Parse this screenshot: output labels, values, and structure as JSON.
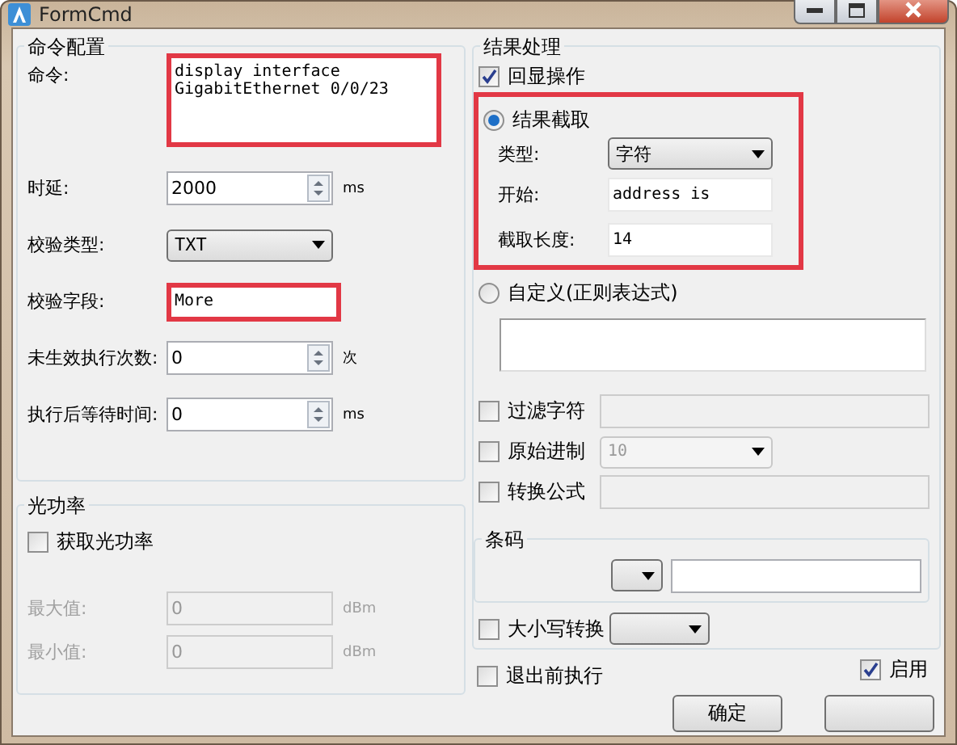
{
  "window": {
    "title": "FormCmd"
  },
  "command_config": {
    "title": "命令配置",
    "rows": [
      {
        "kind": "textarea",
        "label": "命令:",
        "value": "display interface\nGigabitEthernet 0/0/23",
        "highlighted": true
      },
      {
        "kind": "spin",
        "label": "时延:",
        "value": "2000",
        "unit": "ms"
      },
      {
        "kind": "combo",
        "label": "校验类型:",
        "value": "TXT"
      },
      {
        "kind": "text",
        "label": "校验字段:",
        "value": "More",
        "highlighted": true
      },
      {
        "kind": "spin",
        "label": "未生效执行次数:",
        "value": "0",
        "unit": "次"
      },
      {
        "kind": "spin",
        "label": "执行后等待时间:",
        "value": "0",
        "unit": "ms"
      }
    ]
  },
  "optical_power": {
    "title": "光功率",
    "checkbox": {
      "label": "获取光功率",
      "checked": false
    },
    "rows": [
      {
        "label": "最大值:",
        "value": "0",
        "unit": "dBm",
        "disabled": true
      },
      {
        "label": "最小值:",
        "value": "0",
        "unit": "dBm",
        "disabled": true
      }
    ]
  },
  "result": {
    "title": "结果处理",
    "echo": {
      "label": "回显操作",
      "checked": true
    },
    "extract": {
      "label": "结果截取",
      "selected": true,
      "highlighted": true,
      "rows": [
        {
          "kind": "combo",
          "label": "类型:",
          "value": "字符"
        },
        {
          "kind": "text",
          "label": "开始:",
          "value": "address is"
        },
        {
          "kind": "text",
          "label": "截取长度:",
          "value": "14"
        }
      ]
    },
    "custom": {
      "label": "自定义(正则表达式)",
      "selected": false
    },
    "options": [
      {
        "kind": "text",
        "label": "过滤字符",
        "checked": false,
        "disabled": true
      },
      {
        "kind": "combo",
        "label": "原始进制",
        "checked": false,
        "value": "10",
        "disabled": true
      },
      {
        "kind": "text",
        "label": "转换公式",
        "checked": false,
        "disabled": true
      }
    ],
    "barcode": {
      "title": "条码"
    },
    "case": {
      "label": "大小写转换",
      "checked": false
    }
  },
  "run_before_exit": {
    "label": "退出前执行",
    "checked": false
  },
  "enabled": {
    "label": "启用",
    "checked": true
  },
  "buttons": [
    {
      "label": "确定"
    }
  ]
}
